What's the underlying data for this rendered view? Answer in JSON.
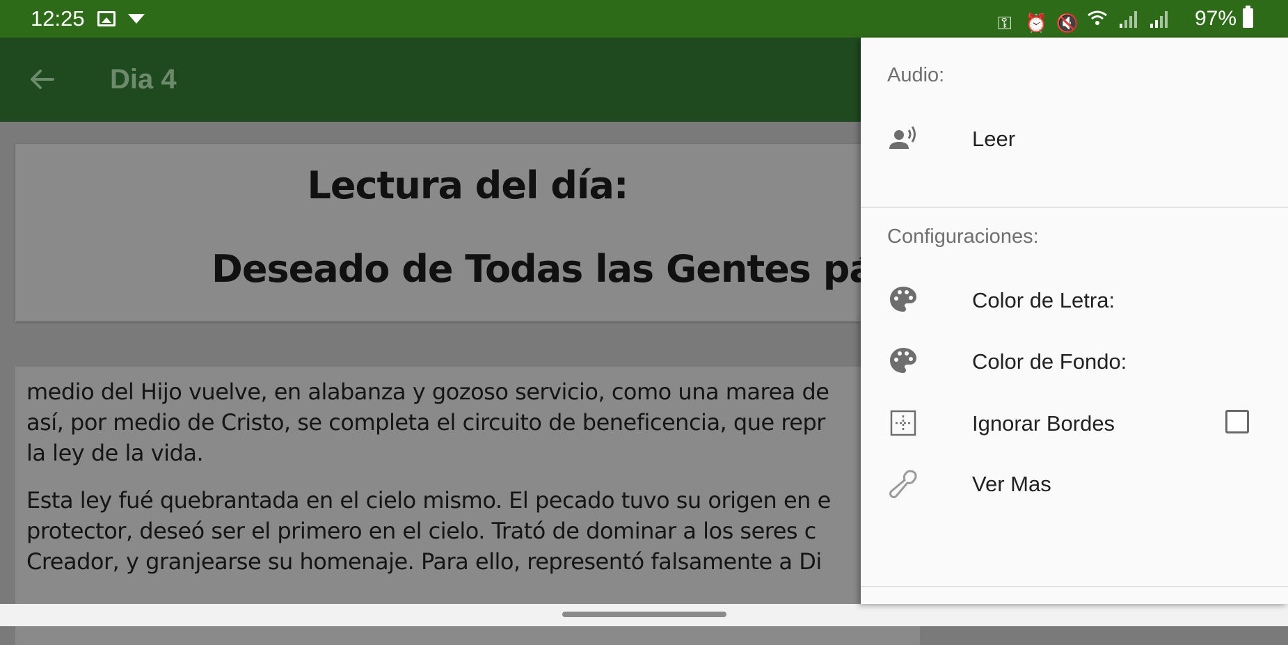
{
  "status_bar": {
    "time": "12:25",
    "battery": "97%",
    "icons": [
      "image-icon",
      "download-icon",
      "key-icon",
      "alarm-icon",
      "mute-icon",
      "wifi-icon",
      "signal-icon",
      "signal-icon",
      "battery-icon"
    ]
  },
  "app_bar": {
    "title": "Dia 4"
  },
  "reading": {
    "title": "Lectura del día:",
    "subtitle": "Deseado de Todas las Gentes pág",
    "paragraph1": [
      "medio del Hijo vuelve, en alabanza y gozoso servicio, como una marea de",
      "así, por medio de Cristo, se completa el circuito de beneficencia, que repr",
      "la ley de la vida."
    ],
    "paragraph2": [
      "Esta ley fué quebrantada en el cielo mismo. El pecado tuvo su origen en e",
      "protector, deseó ser el primero en el cielo. Trató de dominar a los seres c",
      "Creador, y granjearse su homenaje. Para ello, representó falsamente a Di"
    ]
  },
  "menu": {
    "audio_header": "Audio:",
    "read_label": "Leer",
    "config_header": "Configuraciones:",
    "text_color_label": "Color de Letra:",
    "bg_color_label": "Color de Fondo:",
    "ignore_borders_label": "Ignorar Bordes",
    "ignore_borders_checked": false,
    "see_more_label": "Ver Mas"
  },
  "colors": {
    "status_bar": "#2e6b19",
    "app_bar": "#1f4a20",
    "menu_bg": "#fafafa",
    "dim_overlay": "#7a7a7a"
  }
}
